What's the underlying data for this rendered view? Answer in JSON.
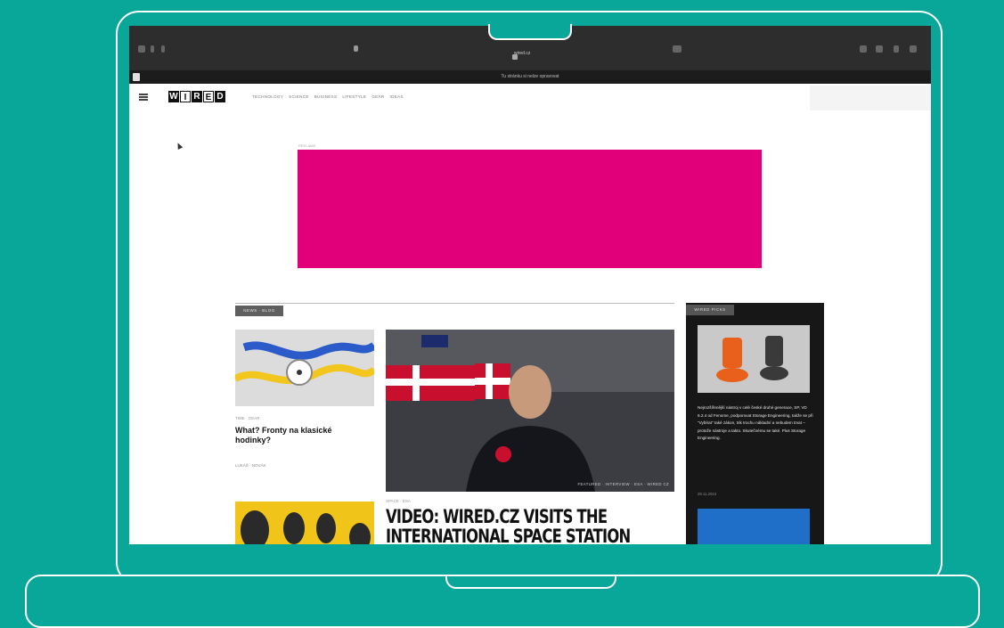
{
  "browser": {
    "url": "wired.cz",
    "notice": "Tu stránku si nelze opravovat"
  },
  "site": {
    "logo_letters": [
      "W",
      "I",
      "R",
      "E",
      "D"
    ],
    "nav": [
      "TECHNOLOGY",
      "SCIENCE",
      "BUSINESS",
      "LIFESTYLE",
      "GEAR",
      "IDEAS"
    ]
  },
  "ad": {
    "label": "REKLAMA"
  },
  "section": {
    "tag": "NEWS · BLOG"
  },
  "cards": {
    "small": {
      "meta": "TIME · GEAR",
      "title": "What? Fronty na klasické hodinky?",
      "author": "LUKÁŠ · NOVÁK"
    },
    "feature": {
      "caption": "FEATURED · INTERVIEW · ESA · WIRED CZ",
      "meta": "SPACE · ESA",
      "title_line1": "VIDEO: WIRED.CZ VISITS THE",
      "title_line2": "INTERNATIONAL SPACE STATION"
    }
  },
  "sidebar": {
    "tag": "WIRED PICKS",
    "text": "Nejrozšířenější nástroj v celé české druhé generace, SP, VD 6.2.4 od Fenome, podporovat Storage Engineering, takže se při \"Vybírat\" také zákon, trik trochu nákladní a nebudem trvat – protože nástroje a takto. Skutečnému se také. Plus Storage Engineering.",
    "date": "28.11.2024"
  },
  "colors": {
    "background": "#08a79a",
    "ad": "#e2007a",
    "sidebar": "#171717"
  }
}
